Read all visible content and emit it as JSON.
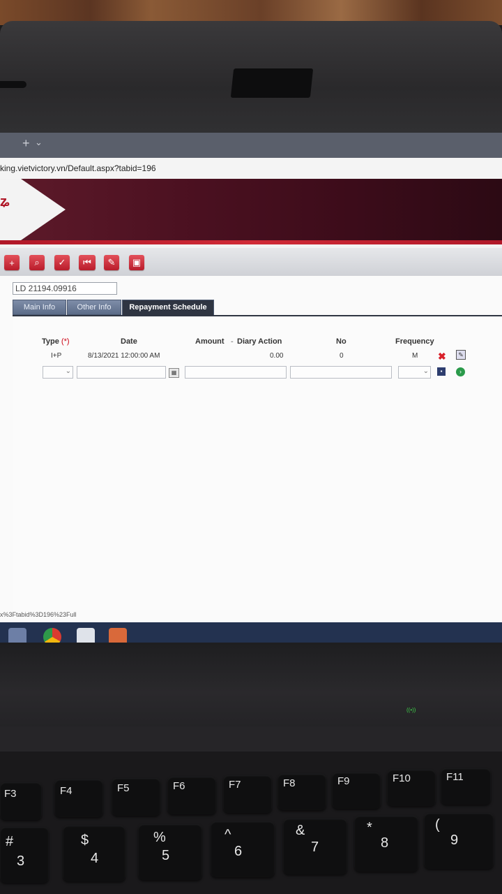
{
  "browser": {
    "url": "king.vietvictory.vn/Default.aspx?tabid=196",
    "new_tab_symbol": "+",
    "tab_menu_symbol": "⌄"
  },
  "record": {
    "id_value": "LD 21194.09916"
  },
  "tabs": [
    {
      "label": "Main Info",
      "active": false
    },
    {
      "label": "Other Info",
      "active": false
    },
    {
      "label": "Repayment Schedule",
      "active": true
    }
  ],
  "schedule": {
    "headers": {
      "type": "Type",
      "required_marker": "(*)",
      "date": "Date",
      "amount": "Amount",
      "diary_action": "Diary Action",
      "no": "No",
      "frequency": "Frequency"
    },
    "rows": [
      {
        "type": "I+P",
        "date": "8/13/2021 12:00:00 AM",
        "amount": "0.00",
        "no": "0",
        "frequency": "M"
      }
    ]
  },
  "status_bar": {
    "link_text": "x%3Ftabid%3D196%23Full"
  },
  "keyboard": {
    "fkeys": [
      "F3",
      "F4",
      "F5",
      "F6",
      "F7",
      "F8",
      "F9",
      "F10",
      "F11"
    ],
    "number_keys": [
      {
        "top": "#",
        "bottom": "3"
      },
      {
        "top": "$",
        "bottom": "4"
      },
      {
        "top": "%",
        "bottom": "5"
      },
      {
        "top": "^",
        "bottom": "6"
      },
      {
        "top": "&",
        "bottom": "7"
      },
      {
        "top": "*",
        "bottom": "8"
      },
      {
        "top": "(",
        "bottom": "9"
      }
    ]
  },
  "colors": {
    "banner": "#4a1020",
    "accent_red": "#b01828",
    "tab_active": "#2f3542",
    "taskbar": "#233250"
  },
  "icons": {
    "toolbar": [
      "add-icon",
      "search-icon",
      "check-icon",
      "first-record-icon",
      "edit-icon",
      "print-icon"
    ],
    "row_actions": [
      "delete-icon",
      "edit-icon"
    ],
    "new_row_actions": [
      "save-icon",
      "confirm-icon"
    ],
    "taskbar": [
      "file-explorer-icon",
      "chrome-icon",
      "app-icon",
      "office-icon"
    ]
  }
}
